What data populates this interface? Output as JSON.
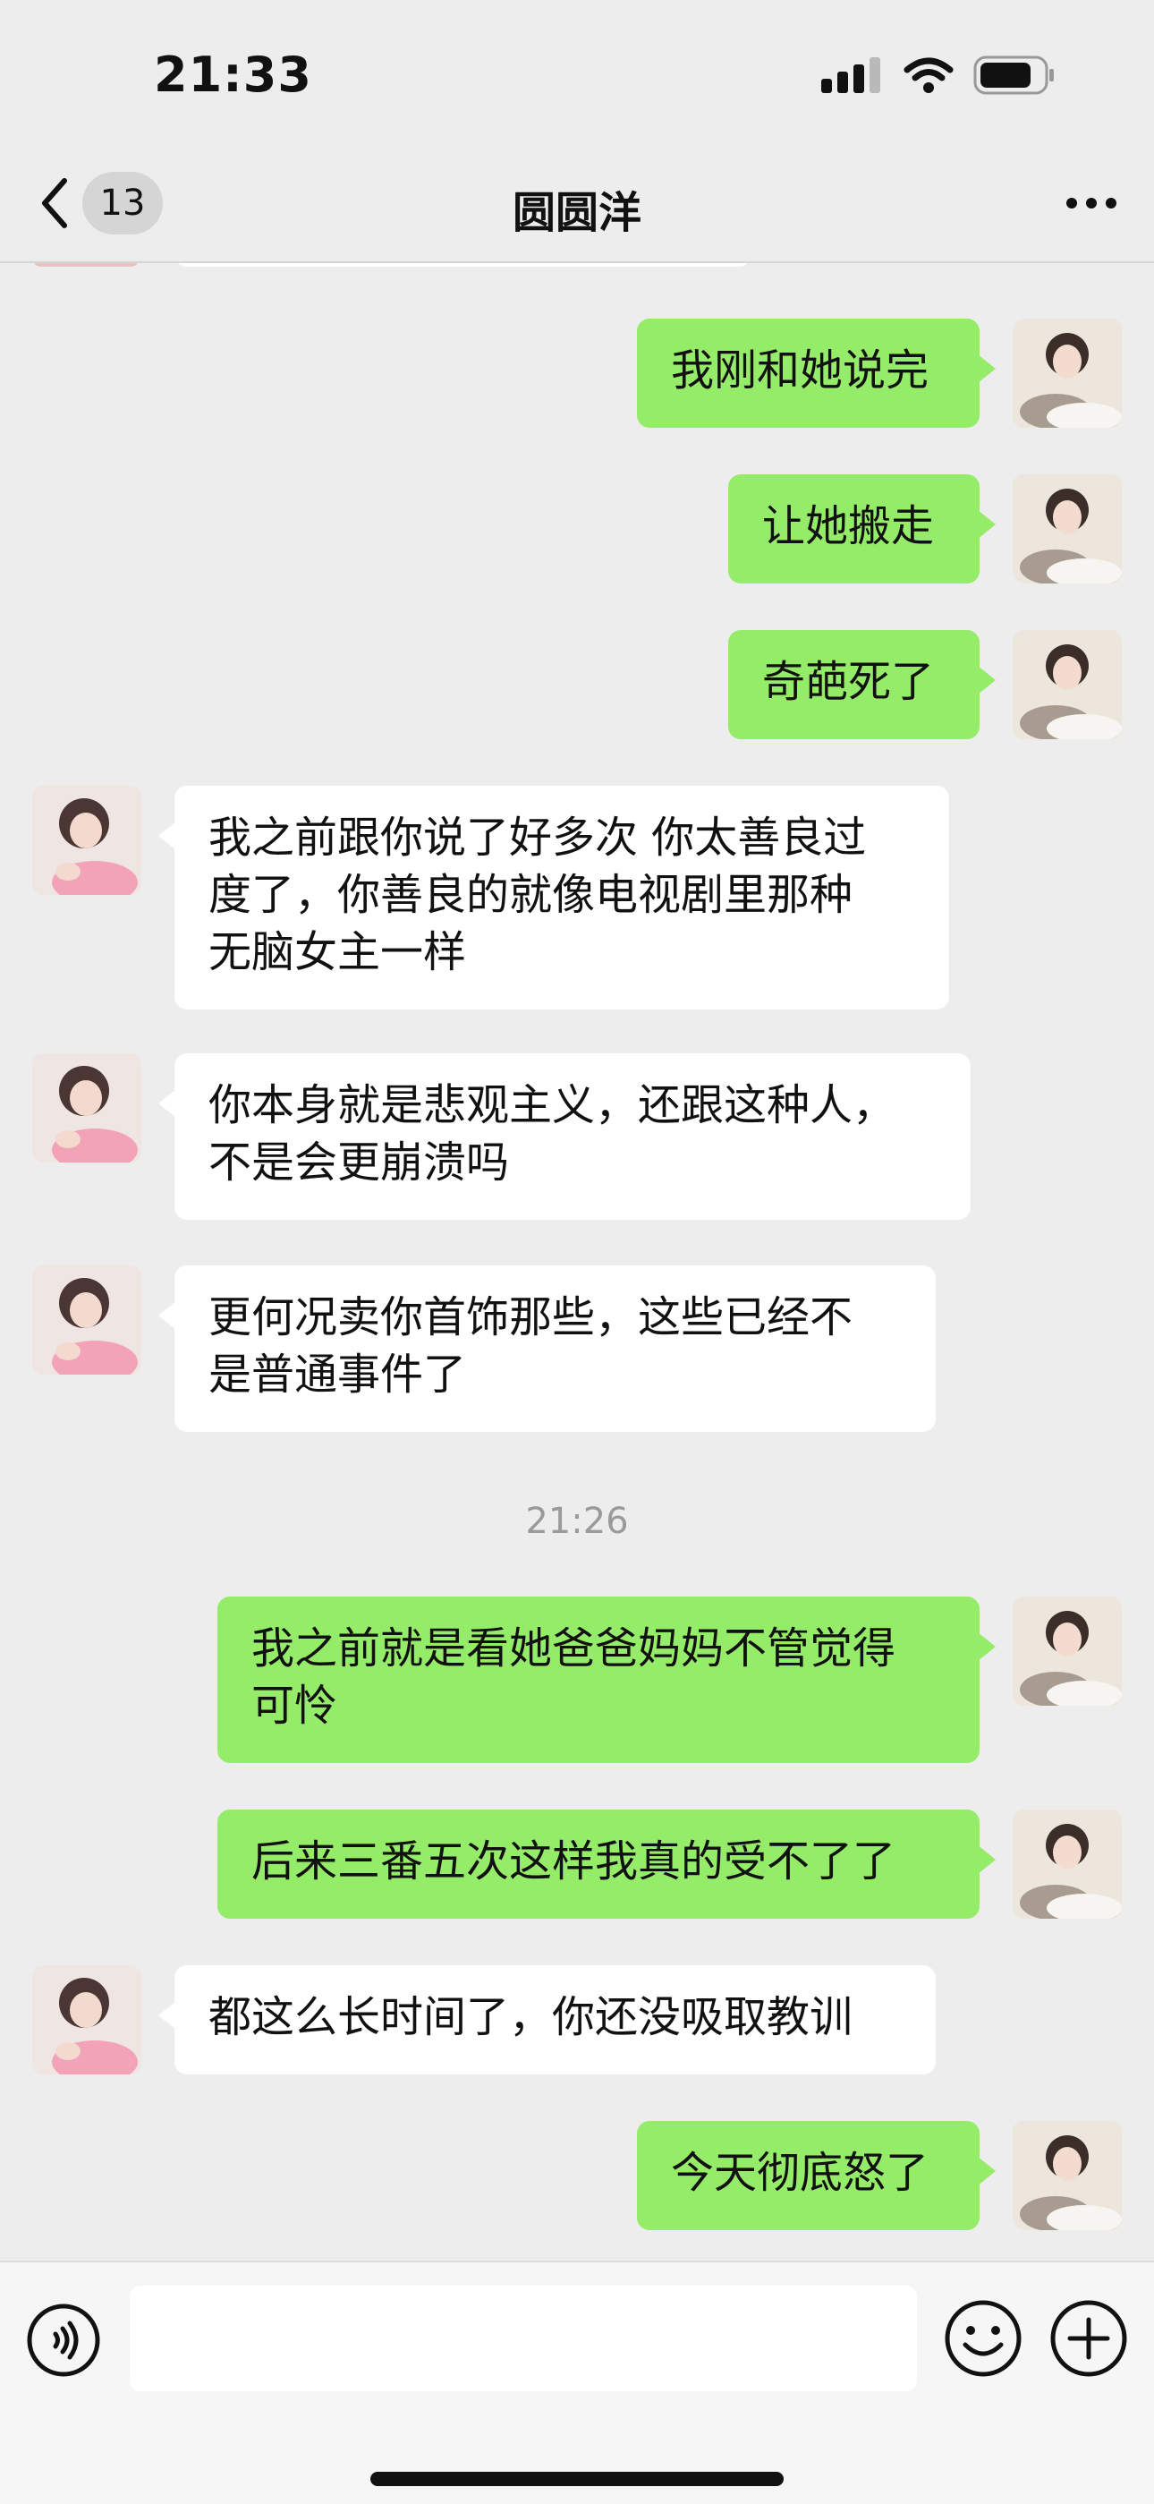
{
  "status": {
    "time": "21:33"
  },
  "nav": {
    "unread_count": "13",
    "title": "圆圆洋"
  },
  "messages": [
    {
      "side": "right",
      "text": "我刚和她说完"
    },
    {
      "side": "right",
      "text": "让她搬走"
    },
    {
      "side": "right",
      "text": "奇葩死了"
    },
    {
      "side": "left",
      "text": "我之前跟你说了好多次 你太善良过\n度了，你善良的就像电视剧里那种\n无脑女主一样"
    },
    {
      "side": "left",
      "text": "你本身就是悲观主义，还跟这种人，\n不是会更崩溃吗"
    },
    {
      "side": "left",
      "text": "更何况卖你首饰那些，这些已经不\n是普通事件了"
    },
    {
      "timestamp": "21:26"
    },
    {
      "side": "right",
      "text": "我之前就是看她爸爸妈妈不管觉得\n可怜"
    },
    {
      "side": "right",
      "text": "后来三番五次这样我真的受不了了"
    },
    {
      "side": "left",
      "text": "都这么长时间了，你还没吸取教训"
    },
    {
      "side": "right",
      "text": "今天彻底怒了"
    }
  ],
  "input": {
    "value": ""
  },
  "colors": {
    "bg": "#ededed",
    "me_bubble": "#95ec69",
    "other_bubble": "#ffffff"
  }
}
